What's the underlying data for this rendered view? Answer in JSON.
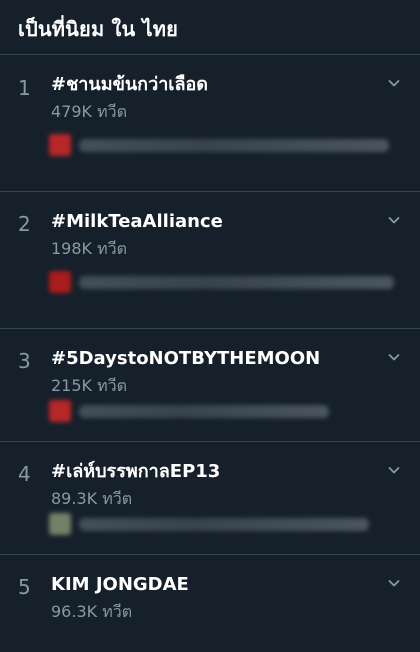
{
  "header": {
    "title": "เป็นที่นิยม ใน ไทย"
  },
  "trends": [
    {
      "rank": "1",
      "name": "#ชานมข้นกว่าเลือด",
      "count": "479K ทวีต",
      "avatar_color": "#c62828"
    },
    {
      "rank": "2",
      "name": "#MilkTeaAlliance",
      "count": "198K ทวีต",
      "avatar_color": "#b71c1c"
    },
    {
      "rank": "3",
      "name": "#5DaystoNOTBYTHEMOON",
      "count": "215K ทวีต",
      "avatar_color": "#c62828"
    },
    {
      "rank": "4",
      "name": "#เล่ห์บรรพกาลEP13",
      "count": "89.3K ทวีต",
      "avatar_color": "#7d8a6b"
    },
    {
      "rank": "5",
      "name": "KIM JONGDAE",
      "count": "96.3K ทวีต"
    }
  ],
  "colors": {
    "background": "#15202b",
    "divider": "#38444d",
    "secondary_text": "#8899a6",
    "primary_text": "#ffffff"
  },
  "icons": {
    "chevron": "chevron-down-icon"
  }
}
